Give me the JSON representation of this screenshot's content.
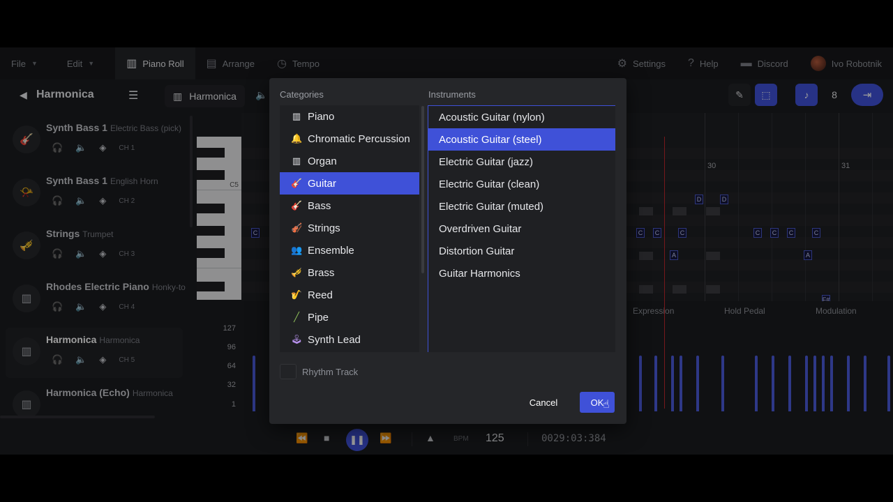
{
  "nav": {
    "file": "File",
    "edit": "Edit",
    "piano_roll": "Piano Roll",
    "arrange": "Arrange",
    "tempo": "Tempo",
    "settings": "Settings",
    "help": "Help",
    "discord": "Discord",
    "user": "Ivo Robotnik"
  },
  "header": {
    "track_title": "Harmonica",
    "instrument": "Harmonica",
    "quantize": "8"
  },
  "tracks": [
    {
      "name": "Synth Bass 1",
      "sub": "Electric Bass (pick)",
      "ch": "CH 1",
      "icon": "guitar-icon"
    },
    {
      "name": "Synth Bass 1",
      "sub": "English Horn",
      "ch": "CH 2",
      "icon": "horn-icon"
    },
    {
      "name": "Strings",
      "sub": "Trumpet",
      "ch": "CH 3",
      "icon": "trumpet-icon"
    },
    {
      "name": "Rhodes Electric Piano",
      "sub": "Honky-to",
      "ch": "CH 4",
      "icon": "piano-icon"
    },
    {
      "name": "Harmonica",
      "sub": "Harmonica",
      "ch": "CH 5",
      "icon": "piano-icon"
    },
    {
      "name": "Harmonica (Echo)",
      "sub": "Harmonica",
      "ch": "",
      "icon": "piano-icon"
    }
  ],
  "roll": {
    "bar_30": "30",
    "bar_31": "31",
    "key_label": "C5"
  },
  "lanes": {
    "expression": "Expression",
    "hold_pedal": "Hold Pedal",
    "modulation": "Modulation",
    "velocity_ticks": [
      "127",
      "96",
      "64",
      "32",
      "1"
    ]
  },
  "transport": {
    "bpm_label": "BPM",
    "bpm": "125",
    "time": "0029:03:384"
  },
  "dialog": {
    "categories_title": "Categories",
    "instruments_title": "Instruments",
    "categories": [
      "Piano",
      "Chromatic Percussion",
      "Organ",
      "Guitar",
      "Bass",
      "Strings",
      "Ensemble",
      "Brass",
      "Reed",
      "Pipe",
      "Synth Lead"
    ],
    "selected_category": "Guitar",
    "instruments": [
      "Acoustic Guitar (nylon)",
      "Acoustic Guitar (steel)",
      "Electric Guitar (jazz)",
      "Electric Guitar (clean)",
      "Electric Guitar (muted)",
      "Overdriven Guitar",
      "Distortion Guitar",
      "Guitar Harmonics"
    ],
    "selected_instrument": "Acoustic Guitar (steel)",
    "rhythm_track": "Rhythm Track",
    "cancel": "Cancel",
    "ok": "OK"
  },
  "colors": {
    "accent": "#3f51d8",
    "playhead": "#c0282d",
    "background": "#1b1c1f"
  }
}
